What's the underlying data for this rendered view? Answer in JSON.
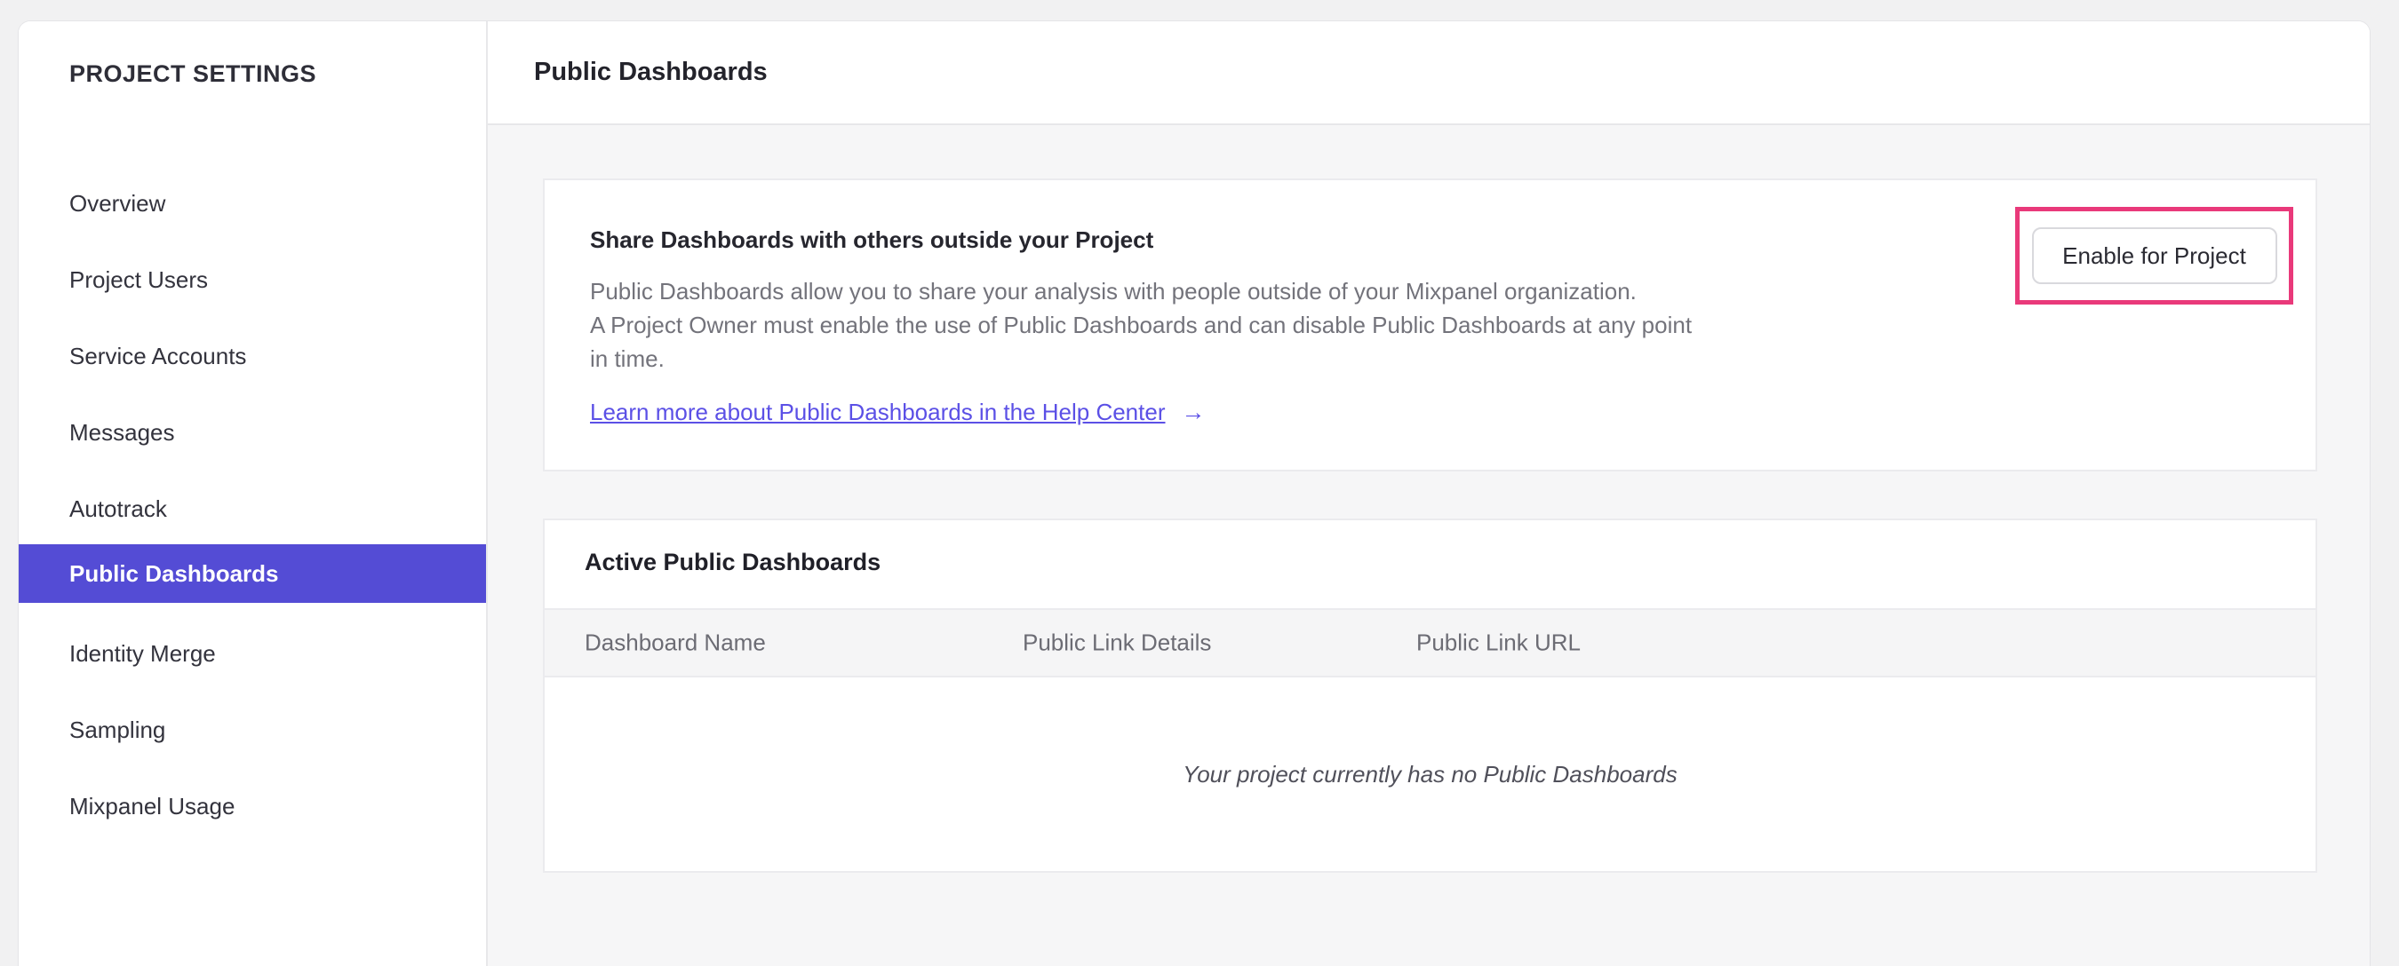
{
  "colors": {
    "accent": "#544cd5",
    "link": "#5b50e6",
    "highlight": "#e9397a"
  },
  "sidebar": {
    "title": "PROJECT SETTINGS",
    "items": [
      {
        "label": "Overview",
        "selected": false
      },
      {
        "label": "Project Users",
        "selected": false
      },
      {
        "label": "Service Accounts",
        "selected": false
      },
      {
        "label": "Messages",
        "selected": false
      },
      {
        "label": "Autotrack",
        "selected": false
      },
      {
        "label": "Public Dashboards",
        "selected": true
      },
      {
        "label": "Identity Merge",
        "selected": false
      },
      {
        "label": "Sampling",
        "selected": false
      },
      {
        "label": "Mixpanel Usage",
        "selected": false
      }
    ]
  },
  "header": {
    "title": "Public Dashboards"
  },
  "share_card": {
    "heading": "Share Dashboards with others outside your Project",
    "body_lines": [
      "Public Dashboards allow you to share your analysis with people outside of your Mixpanel organization.",
      "A Project Owner must enable the use of Public Dashboards and can disable Public Dashboards at any point",
      "in time."
    ],
    "link_label": "Learn more about Public Dashboards in the Help Center",
    "link_arrow": "→",
    "button_label": "Enable for Project"
  },
  "dashboards_card": {
    "heading": "Active Public Dashboards",
    "columns": [
      "Dashboard Name",
      "Public Link Details",
      "Public Link URL"
    ],
    "empty_message": "Your project currently has no Public Dashboards"
  }
}
